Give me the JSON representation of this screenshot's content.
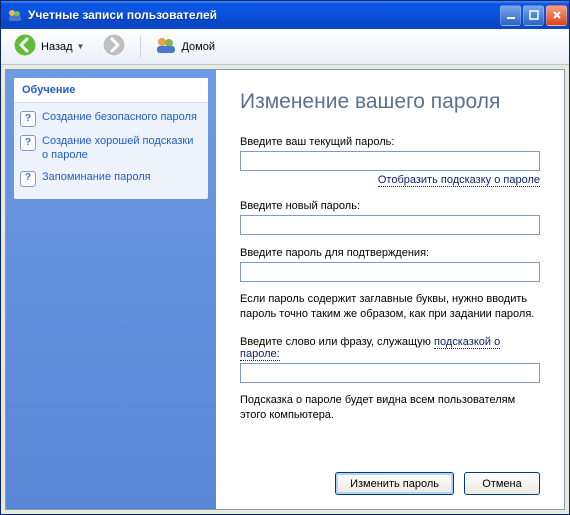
{
  "titlebar": {
    "title": "Учетные записи пользователей"
  },
  "toolbar": {
    "back": "Назад",
    "home": "Домой"
  },
  "sidebar": {
    "heading": "Обучение",
    "items": [
      {
        "label": "Создание безопасного пароля"
      },
      {
        "label": "Создание хорошей подсказки о пароле"
      },
      {
        "label": "Запоминание пароля"
      }
    ]
  },
  "main": {
    "heading": "Изменение вашего пароля",
    "current_label": "Введите ваш текущий пароль:",
    "current_value": "",
    "show_hint": "Отобразить подсказку о пароле",
    "new_label": "Введите новый пароль:",
    "new_value": "",
    "confirm_label": "Введите пароль для подтверждения:",
    "confirm_value": "",
    "caps_note": "Если пароль содержит заглавные буквы, нужно вводить пароль точно таким же образом, как при задании пароля.",
    "hint_label_pre": "Введите слово или фразу, служащую ",
    "hint_label_link": "подсказкой о пароле:",
    "hint_value": "",
    "visibility_note": "Подсказка о пароле будет видна всем пользователям этого компьютера.",
    "submit": "Изменить пароль",
    "cancel": "Отмена"
  }
}
